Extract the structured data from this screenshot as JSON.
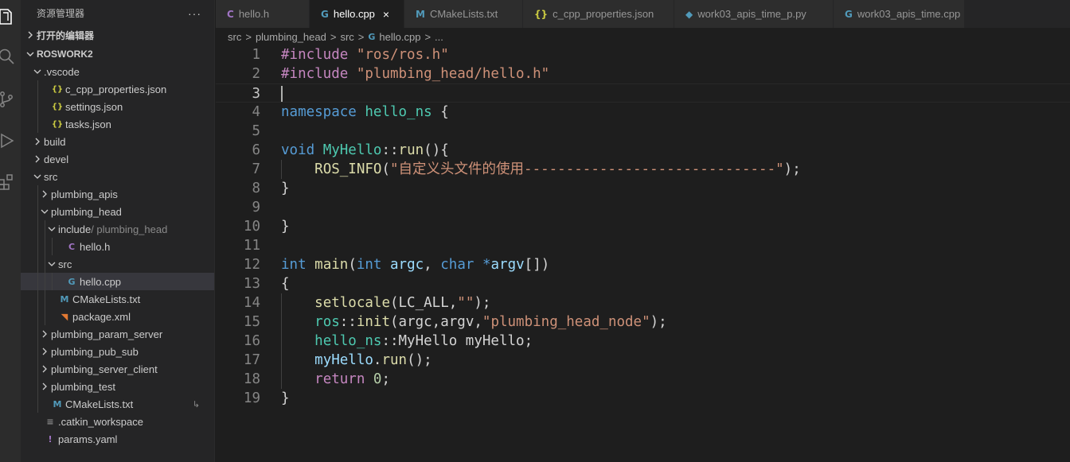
{
  "activity_bar": {
    "icons": [
      "files-icon",
      "search-icon",
      "source-control-icon",
      "run-debug-icon",
      "extensions-icon"
    ]
  },
  "sidebar": {
    "title": "资源管理器",
    "more": "···",
    "open_editors": "打开的编辑器",
    "root": "ROSWORK2",
    "tree": [
      {
        "label": ".vscode",
        "kind": "folder",
        "open": true,
        "depth": 1
      },
      {
        "label": "c_cpp_properties.json",
        "kind": "json",
        "depth": 2
      },
      {
        "label": "settings.json",
        "kind": "json",
        "depth": 2
      },
      {
        "label": "tasks.json",
        "kind": "json",
        "depth": 2
      },
      {
        "label": "build",
        "kind": "folder",
        "open": false,
        "depth": 1
      },
      {
        "label": "devel",
        "kind": "folder",
        "open": false,
        "depth": 1
      },
      {
        "label": "src",
        "kind": "folder",
        "open": true,
        "depth": 1
      },
      {
        "label": "plumbing_apis",
        "kind": "folder",
        "open": false,
        "depth": 2
      },
      {
        "label": "plumbing_head",
        "kind": "folder",
        "open": true,
        "depth": 2
      },
      {
        "label": "include",
        "label2": " / plumbing_head",
        "kind": "folder",
        "open": true,
        "depth": 3
      },
      {
        "label": "hello.h",
        "kind": "c",
        "depth": 4
      },
      {
        "label": "src",
        "kind": "folder",
        "open": true,
        "depth": 3
      },
      {
        "label": "hello.cpp",
        "kind": "cpp",
        "depth": 4,
        "selected": true
      },
      {
        "label": "CMakeLists.txt",
        "kind": "m",
        "depth": 3
      },
      {
        "label": "package.xml",
        "kind": "rss",
        "depth": 3
      },
      {
        "label": "plumbing_param_server",
        "kind": "folder",
        "open": false,
        "depth": 2
      },
      {
        "label": "plumbing_pub_sub",
        "kind": "folder",
        "open": false,
        "depth": 2
      },
      {
        "label": "plumbing_server_client",
        "kind": "folder",
        "open": false,
        "depth": 2
      },
      {
        "label": "plumbing_test",
        "kind": "folder",
        "open": false,
        "depth": 2
      },
      {
        "label": "CMakeLists.txt",
        "kind": "m",
        "depth": 2,
        "badge": "↳"
      },
      {
        "label": ".catkin_workspace",
        "kind": "eq",
        "depth": 1
      },
      {
        "label": "params.yaml",
        "kind": "ex",
        "depth": 1
      }
    ]
  },
  "tabs": [
    {
      "label": "hello.h",
      "icon": "C",
      "icon_class": "ic-c",
      "active": false
    },
    {
      "label": "hello.cpp",
      "icon": "G",
      "icon_class": "ic-cpp",
      "active": true,
      "close": "×"
    },
    {
      "label": "CMakeLists.txt",
      "icon": "M",
      "icon_class": "ic-m",
      "active": false
    },
    {
      "label": "c_cpp_properties.json",
      "icon": "{}",
      "icon_class": "ic-json",
      "active": false
    },
    {
      "label": "work03_apis_time_p.py",
      "icon": "◆",
      "icon_class": "ic-cpp",
      "active": false
    },
    {
      "label": "work03_apis_time.cpp",
      "icon": "G",
      "icon_class": "ic-cpp",
      "active": false
    }
  ],
  "breadcrumb": {
    "parts": [
      "src",
      "plumbing_head",
      "src"
    ],
    "file": "hello.cpp",
    "tail": "..."
  },
  "editor": {
    "cursor_line": 3,
    "lines": [
      [
        [
          "tk-kw",
          "#include"
        ],
        [
          "tk-p",
          " "
        ],
        [
          "tk-str",
          "\"ros/ros.h\""
        ]
      ],
      [
        [
          "tk-kw",
          "#include"
        ],
        [
          "tk-p",
          " "
        ],
        [
          "tk-str",
          "\"plumbing_head/hello.h\""
        ]
      ],
      [],
      [
        [
          "tk-blue",
          "namespace"
        ],
        [
          "tk-p",
          " "
        ],
        [
          "tk-type",
          "hello_ns"
        ],
        [
          "tk-p",
          " {"
        ]
      ],
      [],
      [
        [
          "tk-blue",
          "void"
        ],
        [
          "tk-p",
          " "
        ],
        [
          "tk-type",
          "MyHello"
        ],
        [
          "tk-p",
          "::"
        ],
        [
          "tk-fn",
          "run"
        ],
        [
          "tk-p",
          "(){"
        ]
      ],
      [
        [
          "tk-p",
          "    "
        ],
        [
          "tk-fn",
          "ROS_INFO"
        ],
        [
          "tk-p",
          "("
        ],
        [
          "tk-str",
          "\"自定义头文件的使用------------------------------\""
        ],
        [
          "tk-p",
          ");"
        ]
      ],
      [
        [
          "tk-p",
          "}"
        ]
      ],
      [],
      [
        [
          "tk-p",
          "}"
        ]
      ],
      [],
      [
        [
          "tk-blue",
          "int"
        ],
        [
          "tk-p",
          " "
        ],
        [
          "tk-fn",
          "main"
        ],
        [
          "tk-p",
          "("
        ],
        [
          "tk-blue",
          "int"
        ],
        [
          "tk-p",
          " "
        ],
        [
          "tk-var",
          "argc"
        ],
        [
          "tk-p",
          ", "
        ],
        [
          "tk-blue",
          "char"
        ],
        [
          "tk-p",
          " "
        ],
        [
          "tk-blue",
          "*"
        ],
        [
          "tk-var",
          "argv"
        ],
        [
          "tk-p",
          "[])"
        ]
      ],
      [
        [
          "tk-p",
          "{"
        ]
      ],
      [
        [
          "tk-p",
          "    "
        ],
        [
          "tk-fn",
          "setlocale"
        ],
        [
          "tk-p",
          "(LC_ALL,"
        ],
        [
          "tk-str",
          "\"\""
        ],
        [
          "tk-p",
          ");"
        ]
      ],
      [
        [
          "tk-p",
          "    "
        ],
        [
          "tk-type",
          "ros"
        ],
        [
          "tk-p",
          "::"
        ],
        [
          "tk-fn",
          "init"
        ],
        [
          "tk-p",
          "(argc,argv,"
        ],
        [
          "tk-str",
          "\"plumbing_head_node\""
        ],
        [
          "tk-p",
          ");"
        ]
      ],
      [
        [
          "tk-p",
          "    "
        ],
        [
          "tk-type",
          "hello_ns"
        ],
        [
          "tk-p",
          "::MyHello myHello;"
        ]
      ],
      [
        [
          "tk-p",
          "    "
        ],
        [
          "tk-var",
          "myHello"
        ],
        [
          "tk-p",
          "."
        ],
        [
          "tk-fn",
          "run"
        ],
        [
          "tk-p",
          "();"
        ]
      ],
      [
        [
          "tk-p",
          "    "
        ],
        [
          "tk-kw",
          "return"
        ],
        [
          "tk-p",
          " "
        ],
        [
          "tk-num",
          "0"
        ],
        [
          "tk-p",
          ";"
        ]
      ],
      [
        [
          "tk-p",
          "}"
        ]
      ]
    ]
  }
}
